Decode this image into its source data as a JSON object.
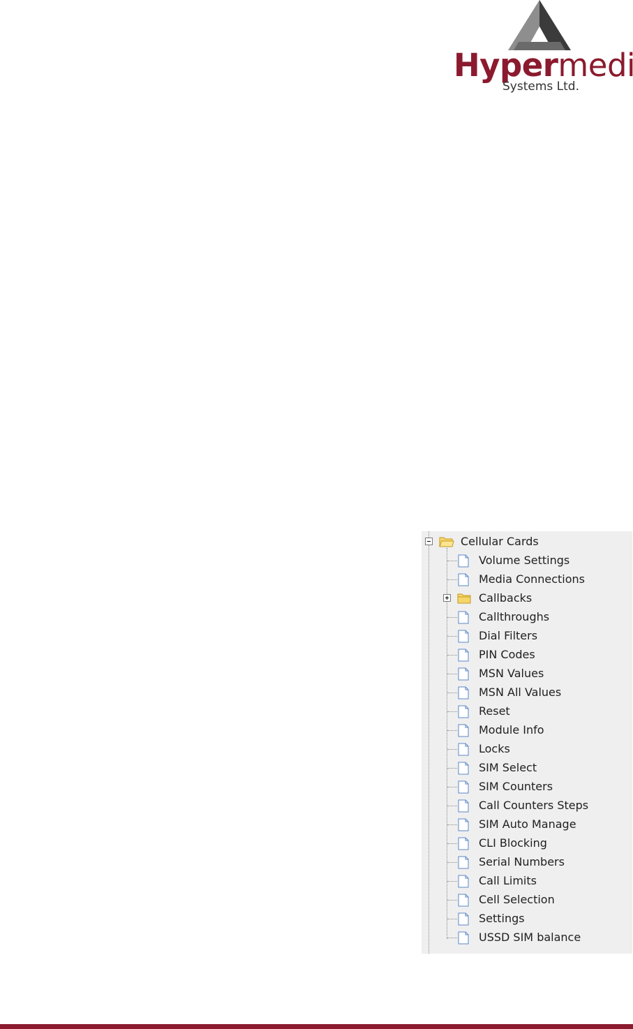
{
  "logo": {
    "word_bold": "Hyper",
    "word_light": "media",
    "subtitle": "Systems Ltd.",
    "icon": "triangle-logo-icon",
    "brand_color": "#8b1a2e"
  },
  "tree": {
    "root": {
      "label": "Cellular Cards",
      "icon": "folder-open-icon",
      "expanded": true
    },
    "items": [
      {
        "label": "Volume Settings",
        "icon": "document-icon"
      },
      {
        "label": "Media Connections",
        "icon": "document-icon"
      },
      {
        "label": "Callbacks",
        "icon": "folder-icon",
        "collapsed": true
      },
      {
        "label": "Callthroughs",
        "icon": "document-icon"
      },
      {
        "label": "Dial Filters",
        "icon": "document-icon"
      },
      {
        "label": "PIN Codes",
        "icon": "document-icon"
      },
      {
        "label": "MSN Values",
        "icon": "document-icon"
      },
      {
        "label": "MSN All Values",
        "icon": "document-icon"
      },
      {
        "label": "Reset",
        "icon": "document-icon"
      },
      {
        "label": "Module Info",
        "icon": "document-icon"
      },
      {
        "label": "Locks",
        "icon": "document-icon"
      },
      {
        "label": "SIM Select",
        "icon": "document-icon"
      },
      {
        "label": "SIM Counters",
        "icon": "document-icon"
      },
      {
        "label": "Call Counters Steps",
        "icon": "document-icon"
      },
      {
        "label": "SIM Auto Manage",
        "icon": "document-icon"
      },
      {
        "label": "CLI Blocking",
        "icon": "document-icon"
      },
      {
        "label": "Serial Numbers",
        "icon": "document-icon"
      },
      {
        "label": "Call Limits",
        "icon": "document-icon"
      },
      {
        "label": "Cell Selection",
        "icon": "document-icon"
      },
      {
        "label": "Settings",
        "icon": "document-icon"
      },
      {
        "label": "USSD SIM balance",
        "icon": "document-icon"
      }
    ]
  },
  "colors": {
    "panel_bg": "#efefef",
    "footer_rule": "#8b1a2e",
    "folder_fill": "#f6d66b",
    "folder_stroke": "#c59a1f",
    "doc_stroke": "#5b87c7",
    "doc_fill": "#ffffff"
  }
}
